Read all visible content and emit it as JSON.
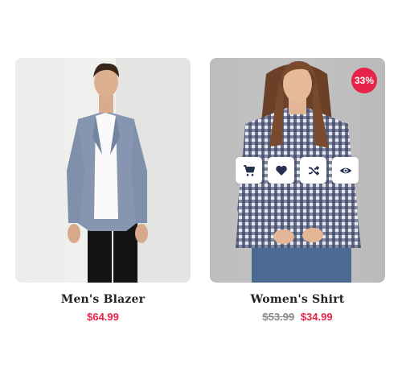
{
  "products": [
    {
      "name": "Men's Blazer",
      "price": "$64.99",
      "image_icon": "man-in-blazer-photo"
    },
    {
      "name": "Women's Shirt",
      "old_price": "$53.99",
      "price": "$34.99",
      "discount_badge": "33%",
      "image_icon": "woman-in-plaid-shirt-photo",
      "actions": [
        {
          "icon": "cart-icon"
        },
        {
          "icon": "heart-icon"
        },
        {
          "icon": "shuffle-icon"
        },
        {
          "icon": "eye-icon"
        }
      ]
    }
  ],
  "colors": {
    "accent": "#e8234a",
    "text": "#222222",
    "muted": "#8a8a8a"
  }
}
